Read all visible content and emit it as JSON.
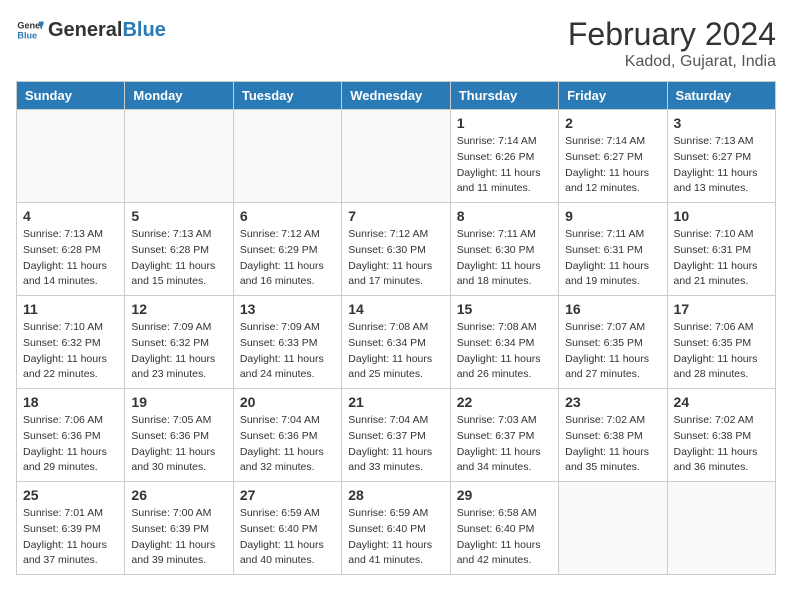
{
  "header": {
    "logo_general": "General",
    "logo_blue": "Blue",
    "month_year": "February 2024",
    "location": "Kadod, Gujarat, India"
  },
  "days_of_week": [
    "Sunday",
    "Monday",
    "Tuesday",
    "Wednesday",
    "Thursday",
    "Friday",
    "Saturday"
  ],
  "weeks": [
    [
      {
        "day": "",
        "info": ""
      },
      {
        "day": "",
        "info": ""
      },
      {
        "day": "",
        "info": ""
      },
      {
        "day": "",
        "info": ""
      },
      {
        "day": "1",
        "info": "Sunrise: 7:14 AM\nSunset: 6:26 PM\nDaylight: 11 hours and 11 minutes."
      },
      {
        "day": "2",
        "info": "Sunrise: 7:14 AM\nSunset: 6:27 PM\nDaylight: 11 hours and 12 minutes."
      },
      {
        "day": "3",
        "info": "Sunrise: 7:13 AM\nSunset: 6:27 PM\nDaylight: 11 hours and 13 minutes."
      }
    ],
    [
      {
        "day": "4",
        "info": "Sunrise: 7:13 AM\nSunset: 6:28 PM\nDaylight: 11 hours and 14 minutes."
      },
      {
        "day": "5",
        "info": "Sunrise: 7:13 AM\nSunset: 6:28 PM\nDaylight: 11 hours and 15 minutes."
      },
      {
        "day": "6",
        "info": "Sunrise: 7:12 AM\nSunset: 6:29 PM\nDaylight: 11 hours and 16 minutes."
      },
      {
        "day": "7",
        "info": "Sunrise: 7:12 AM\nSunset: 6:30 PM\nDaylight: 11 hours and 17 minutes."
      },
      {
        "day": "8",
        "info": "Sunrise: 7:11 AM\nSunset: 6:30 PM\nDaylight: 11 hours and 18 minutes."
      },
      {
        "day": "9",
        "info": "Sunrise: 7:11 AM\nSunset: 6:31 PM\nDaylight: 11 hours and 19 minutes."
      },
      {
        "day": "10",
        "info": "Sunrise: 7:10 AM\nSunset: 6:31 PM\nDaylight: 11 hours and 21 minutes."
      }
    ],
    [
      {
        "day": "11",
        "info": "Sunrise: 7:10 AM\nSunset: 6:32 PM\nDaylight: 11 hours and 22 minutes."
      },
      {
        "day": "12",
        "info": "Sunrise: 7:09 AM\nSunset: 6:32 PM\nDaylight: 11 hours and 23 minutes."
      },
      {
        "day": "13",
        "info": "Sunrise: 7:09 AM\nSunset: 6:33 PM\nDaylight: 11 hours and 24 minutes."
      },
      {
        "day": "14",
        "info": "Sunrise: 7:08 AM\nSunset: 6:34 PM\nDaylight: 11 hours and 25 minutes."
      },
      {
        "day": "15",
        "info": "Sunrise: 7:08 AM\nSunset: 6:34 PM\nDaylight: 11 hours and 26 minutes."
      },
      {
        "day": "16",
        "info": "Sunrise: 7:07 AM\nSunset: 6:35 PM\nDaylight: 11 hours and 27 minutes."
      },
      {
        "day": "17",
        "info": "Sunrise: 7:06 AM\nSunset: 6:35 PM\nDaylight: 11 hours and 28 minutes."
      }
    ],
    [
      {
        "day": "18",
        "info": "Sunrise: 7:06 AM\nSunset: 6:36 PM\nDaylight: 11 hours and 29 minutes."
      },
      {
        "day": "19",
        "info": "Sunrise: 7:05 AM\nSunset: 6:36 PM\nDaylight: 11 hours and 30 minutes."
      },
      {
        "day": "20",
        "info": "Sunrise: 7:04 AM\nSunset: 6:36 PM\nDaylight: 11 hours and 32 minutes."
      },
      {
        "day": "21",
        "info": "Sunrise: 7:04 AM\nSunset: 6:37 PM\nDaylight: 11 hours and 33 minutes."
      },
      {
        "day": "22",
        "info": "Sunrise: 7:03 AM\nSunset: 6:37 PM\nDaylight: 11 hours and 34 minutes."
      },
      {
        "day": "23",
        "info": "Sunrise: 7:02 AM\nSunset: 6:38 PM\nDaylight: 11 hours and 35 minutes."
      },
      {
        "day": "24",
        "info": "Sunrise: 7:02 AM\nSunset: 6:38 PM\nDaylight: 11 hours and 36 minutes."
      }
    ],
    [
      {
        "day": "25",
        "info": "Sunrise: 7:01 AM\nSunset: 6:39 PM\nDaylight: 11 hours and 37 minutes."
      },
      {
        "day": "26",
        "info": "Sunrise: 7:00 AM\nSunset: 6:39 PM\nDaylight: 11 hours and 39 minutes."
      },
      {
        "day": "27",
        "info": "Sunrise: 6:59 AM\nSunset: 6:40 PM\nDaylight: 11 hours and 40 minutes."
      },
      {
        "day": "28",
        "info": "Sunrise: 6:59 AM\nSunset: 6:40 PM\nDaylight: 11 hours and 41 minutes."
      },
      {
        "day": "29",
        "info": "Sunrise: 6:58 AM\nSunset: 6:40 PM\nDaylight: 11 hours and 42 minutes."
      },
      {
        "day": "",
        "info": ""
      },
      {
        "day": "",
        "info": ""
      }
    ]
  ]
}
